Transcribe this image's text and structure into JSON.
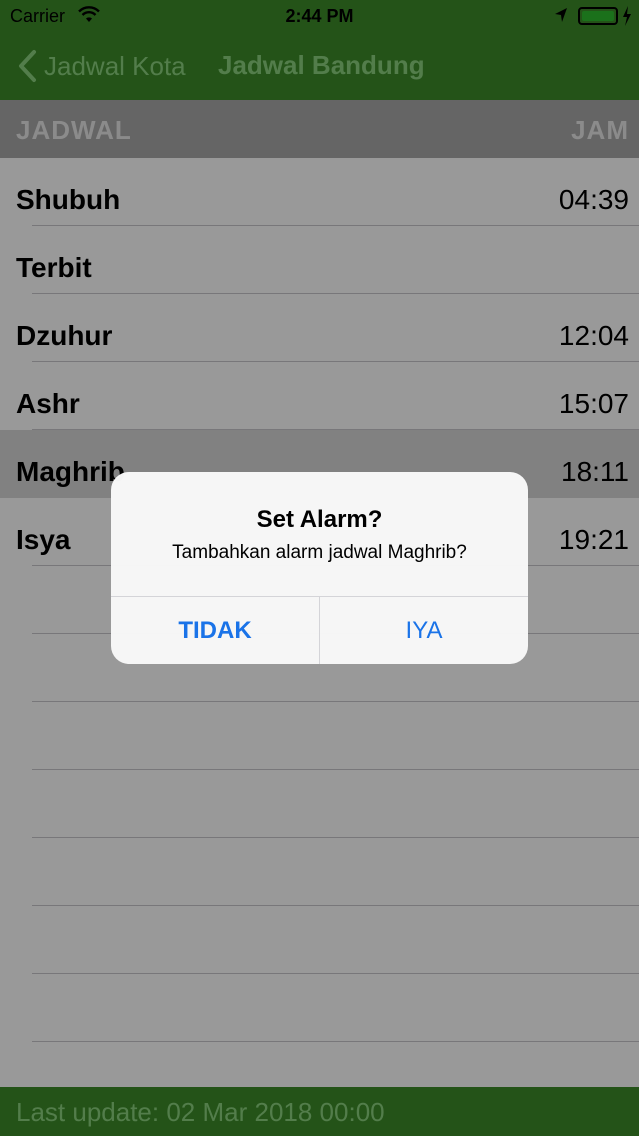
{
  "status_bar": {
    "carrier": "Carrier",
    "time": "2:44 PM"
  },
  "nav": {
    "back_label": "Jadwal Kota",
    "title": "Jadwal Bandung"
  },
  "table": {
    "header_left": "JADWAL",
    "header_right": "JAM",
    "rows": [
      {
        "name": "Shubuh",
        "time": "04:39"
      },
      {
        "name": "Terbit",
        "time": ""
      },
      {
        "name": "Dzuhur",
        "time": "12:04"
      },
      {
        "name": "Ashr",
        "time": "15:07"
      },
      {
        "name": "Maghrib",
        "time": "18:11"
      },
      {
        "name": "Isya",
        "time": "19:21"
      }
    ],
    "selected_index": 4
  },
  "footer": {
    "text": "Last update: 02 Mar 2018 00:00"
  },
  "alert": {
    "title": "Set Alarm?",
    "message": "Tambahkan alarm jadwal Maghrib?",
    "cancel_label": "TIDAK",
    "confirm_label": "IYA"
  },
  "colors": {
    "brand_green": "#3c8b29",
    "nav_text": "#8ad17e",
    "alert_button": "#1a73e8"
  }
}
